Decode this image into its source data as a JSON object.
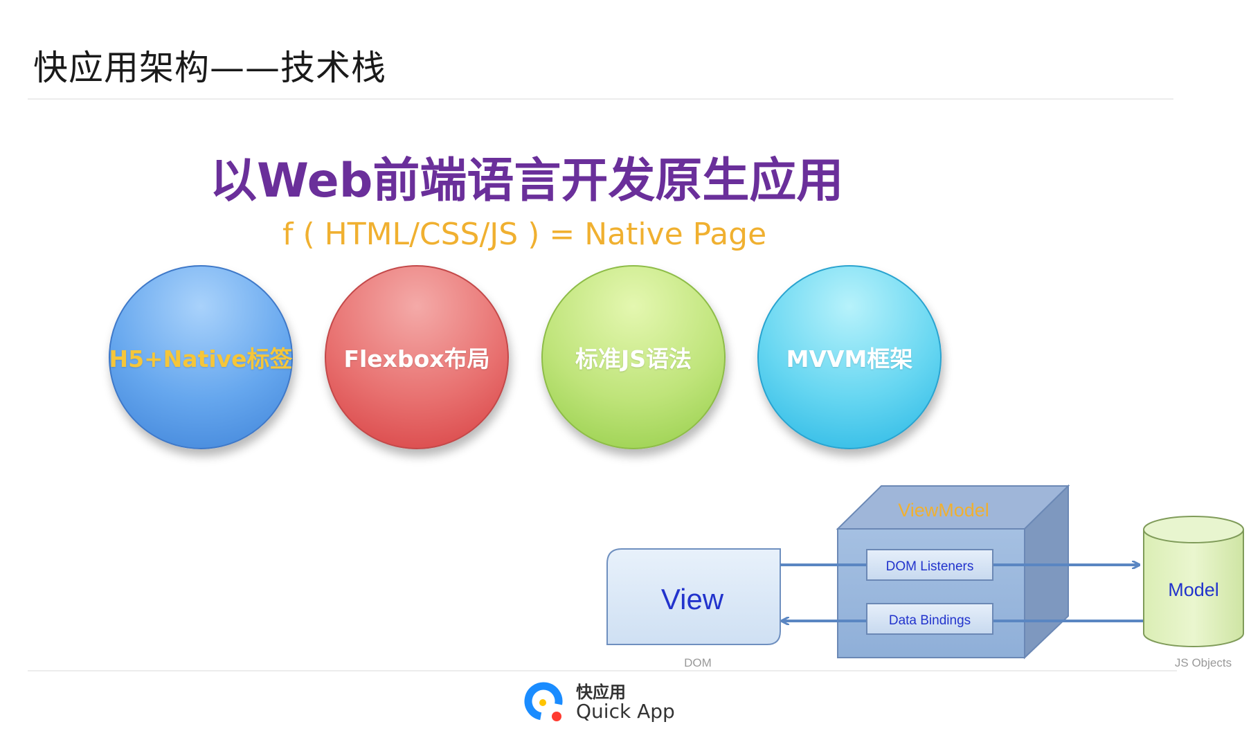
{
  "slide": {
    "title": "快应用架构——技术栈",
    "headline": "以Web前端语言开发原生应用",
    "formula": "f ( HTML/CSS/JS ) = Native Page"
  },
  "circles": [
    {
      "label": "H5+Native标签",
      "text_color": "#f5c63a",
      "fill_color": "#5a9be8"
    },
    {
      "label": "Flexbox布局",
      "text_color": "#ffffff",
      "fill_color": "#e55c5c"
    },
    {
      "label": "标准JS语法",
      "text_color": "#ffffff",
      "fill_color": "#b0dc66"
    },
    {
      "label": "MVVM框架",
      "text_color": "#ffffff",
      "fill_color": "#4fcbec"
    }
  ],
  "diagram": {
    "view": "View",
    "viewmodel": "ViewModel",
    "dom_listeners": "DOM Listeners",
    "data_bindings": "Data Bindings",
    "model": "Model",
    "dom_caption": "DOM",
    "js_objects_caption": "JS Objects"
  },
  "footer": {
    "logo_cn": "快应用",
    "logo_en": "Quick App"
  },
  "colors": {
    "title": "#1a1a1a",
    "headline": "#6a2f9a",
    "formula": "#f0b030",
    "link_text": "#2233cc",
    "viewmodel_label": "#f0b030"
  }
}
